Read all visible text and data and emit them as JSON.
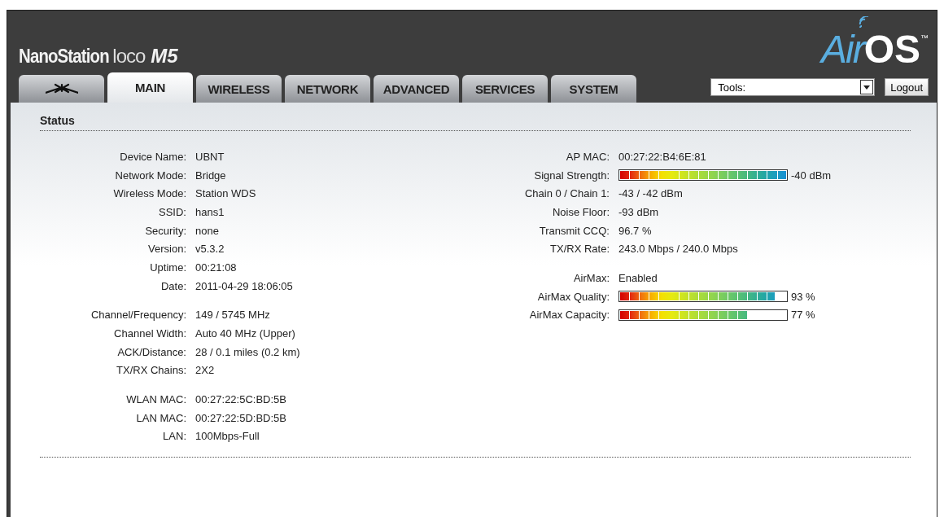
{
  "header": {
    "product": "NanoStation",
    "product_variant": "loco",
    "model": "M5",
    "brand": "AirOS",
    "trademark": "™"
  },
  "tabs": [
    {
      "kind": "logo",
      "selected": false
    },
    {
      "kind": "text",
      "label": "MAIN",
      "selected": true
    },
    {
      "kind": "text",
      "label": "WIRELESS",
      "selected": false
    },
    {
      "kind": "text",
      "label": "NETWORK",
      "selected": false
    },
    {
      "kind": "text",
      "label": "ADVANCED",
      "selected": false
    },
    {
      "kind": "text",
      "label": "SERVICES",
      "selected": false
    },
    {
      "kind": "text",
      "label": "SYSTEM",
      "selected": false
    }
  ],
  "tools": {
    "value": "Tools:"
  },
  "logout": "Logout",
  "status": {
    "title": "Status",
    "left_groups": [
      [
        {
          "label": "Device Name:",
          "value": "UBNT"
        },
        {
          "label": "Network Mode:",
          "value": "Bridge"
        },
        {
          "label": "Wireless Mode:",
          "value": "Station WDS"
        },
        {
          "label": "SSID:",
          "value": "hans1"
        },
        {
          "label": "Security:",
          "value": "none"
        },
        {
          "label": "Version:",
          "value": "v5.3.2"
        },
        {
          "label": "Uptime:",
          "value": "00:21:08"
        },
        {
          "label": "Date:",
          "value": "2011-04-29 18:06:05"
        }
      ],
      [
        {
          "label": "Channel/Frequency:",
          "value": "149 / 5745 MHz"
        },
        {
          "label": "Channel Width:",
          "value": "Auto 40 MHz (Upper)"
        },
        {
          "label": "ACK/Distance:",
          "value": "28 / 0.1 miles (0.2 km)"
        },
        {
          "label": "TX/RX Chains:",
          "value": "2X2"
        }
      ],
      [
        {
          "label": "WLAN MAC:",
          "value": "00:27:22:5C:BD:5B"
        },
        {
          "label": "LAN MAC:",
          "value": "00:27:22:5D:BD:5B"
        },
        {
          "label": "LAN:",
          "value": "100Mbps-Full"
        }
      ]
    ],
    "right_groups": [
      [
        {
          "kind": "text",
          "label": "AP MAC:",
          "value": "00:27:22:B4:6E:81"
        },
        {
          "kind": "meter",
          "label": "Signal Strength:",
          "level": 1,
          "value": "-40 dBm"
        },
        {
          "kind": "text",
          "label": "Chain 0 / Chain 1:",
          "value": "-43 / -42 dBm"
        },
        {
          "kind": "text",
          "label": "Noise Floor:",
          "value": "-93 dBm"
        },
        {
          "kind": "text",
          "label": "Transmit CCQ:",
          "value": "96.7 %"
        },
        {
          "kind": "text",
          "label": "TX/RX Rate:",
          "value": "243.0 Mbps / 240.0 Mbps"
        }
      ],
      [
        {
          "kind": "text",
          "label": "AirMax:",
          "value": "Enabled"
        },
        {
          "kind": "meter",
          "label": "AirMax Quality:",
          "level": 0.93,
          "value": "93 %"
        },
        {
          "kind": "meter",
          "label": "AirMax Capacity:",
          "level": 0.77,
          "value": "77 %"
        }
      ]
    ]
  }
}
